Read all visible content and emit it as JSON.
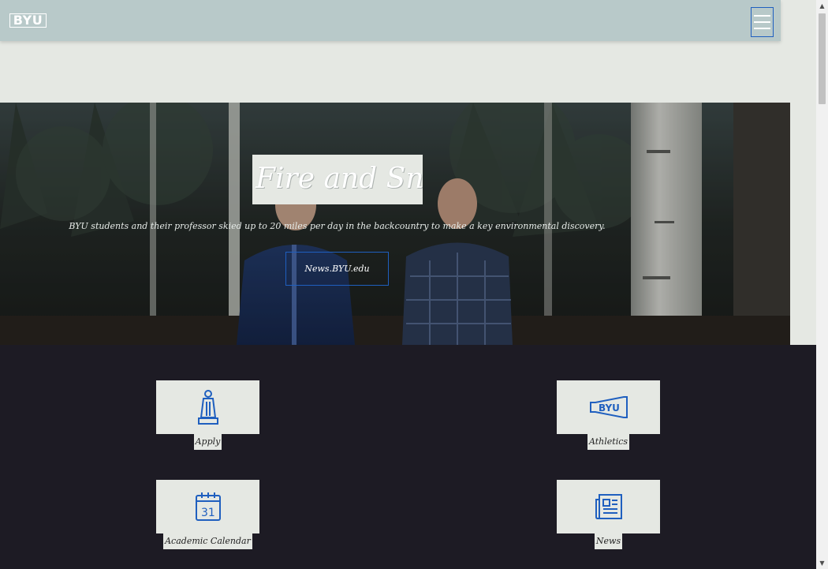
{
  "header": {
    "logo_text": "BYU",
    "menu_icon": "hamburger-menu-icon"
  },
  "hero": {
    "title": "Fire and Snow",
    "subtitle": "BYU students and their professor skied up to 20 miles per day in the backcountry to make a key environmental discovery.",
    "link_label": "News.BYU.edu"
  },
  "quick_links": [
    {
      "label": "Apply",
      "icon": "graduate-statue-icon"
    },
    {
      "label": "Athletics",
      "icon": "byu-megaphone-icon"
    },
    {
      "label": "Academic Calendar",
      "icon": "calendar-31-icon"
    },
    {
      "label": "News",
      "icon": "newspaper-icon"
    }
  ],
  "colors": {
    "header_bg": "#b8c9c9",
    "page_bg": "#e5e8e3",
    "quick_bg": "#1d1b24",
    "accent_blue": "#1f5fbf"
  }
}
